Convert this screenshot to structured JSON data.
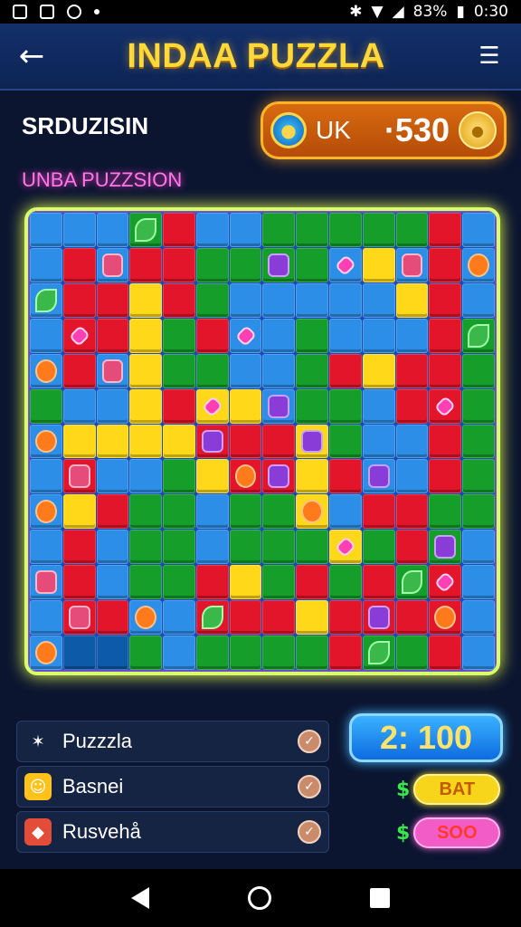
{
  "status_bar": {
    "battery": "83%",
    "time": "0:30"
  },
  "header": {
    "title": "INDAA PUZZLA"
  },
  "section": {
    "title": "SRDUZISIN"
  },
  "score": {
    "label": "UK",
    "value": "·530"
  },
  "subtitle": "UNBA PUZZSION",
  "board": {
    "rows": [
      "BBBGRBBGGGGGRB",
      "BRBRRGGGGBYBRB",
      "BRRYRGBBBBBYRB",
      "BRRYGRBBGBBBRG",
      "BRBYGGBBGRYRRG",
      "GBBYRYYBGGBRRG",
      "BYYYYRRRYGBBRG",
      "BRBBGYRRYRBBRG",
      "BYRGGBGGYBRRGG",
      "BRBGGBGGGYGRGB",
      "BRBGGRYGRGRGRB",
      "BRRBBRRRYRRRRB",
      "BDDGBGGGGRGGRB"
    ],
    "pieces": [
      {
        "row": 0,
        "col": 3,
        "type": "leaf"
      },
      {
        "row": 1,
        "col": 2,
        "type": "box"
      },
      {
        "row": 1,
        "col": 7,
        "type": "purple"
      },
      {
        "row": 1,
        "col": 9,
        "type": "gem"
      },
      {
        "row": 1,
        "col": 11,
        "type": "box"
      },
      {
        "row": 1,
        "col": 13,
        "type": "orange"
      },
      {
        "row": 2,
        "col": 0,
        "type": "leaf"
      },
      {
        "row": 3,
        "col": 1,
        "type": "gem"
      },
      {
        "row": 3,
        "col": 6,
        "type": "gem"
      },
      {
        "row": 3,
        "col": 13,
        "type": "leaf"
      },
      {
        "row": 4,
        "col": 0,
        "type": "orange"
      },
      {
        "row": 4,
        "col": 2,
        "type": "box"
      },
      {
        "row": 5,
        "col": 5,
        "type": "gem"
      },
      {
        "row": 5,
        "col": 7,
        "type": "purple"
      },
      {
        "row": 5,
        "col": 12,
        "type": "gem"
      },
      {
        "row": 6,
        "col": 0,
        "type": "orange"
      },
      {
        "row": 6,
        "col": 5,
        "type": "purple"
      },
      {
        "row": 6,
        "col": 8,
        "type": "purple"
      },
      {
        "row": 7,
        "col": 1,
        "type": "box"
      },
      {
        "row": 7,
        "col": 6,
        "type": "orange"
      },
      {
        "row": 7,
        "col": 7,
        "type": "purple"
      },
      {
        "row": 7,
        "col": 10,
        "type": "purple"
      },
      {
        "row": 8,
        "col": 0,
        "type": "orange"
      },
      {
        "row": 8,
        "col": 8,
        "type": "orange"
      },
      {
        "row": 9,
        "col": 9,
        "type": "gem"
      },
      {
        "row": 9,
        "col": 12,
        "type": "purple"
      },
      {
        "row": 10,
        "col": 0,
        "type": "box"
      },
      {
        "row": 10,
        "col": 11,
        "type": "leaf"
      },
      {
        "row": 10,
        "col": 12,
        "type": "gem"
      },
      {
        "row": 11,
        "col": 1,
        "type": "box"
      },
      {
        "row": 11,
        "col": 3,
        "type": "orange"
      },
      {
        "row": 11,
        "col": 5,
        "type": "leaf"
      },
      {
        "row": 11,
        "col": 10,
        "type": "purple"
      },
      {
        "row": 11,
        "col": 12,
        "type": "orange"
      },
      {
        "row": 12,
        "col": 0,
        "type": "orange"
      },
      {
        "row": 12,
        "col": 10,
        "type": "leaf"
      }
    ]
  },
  "list": [
    {
      "label": "Puzzzla",
      "icon": "star-icon"
    },
    {
      "label": "Basnei",
      "icon": "smiley-icon"
    },
    {
      "label": "Rusvehå",
      "icon": "gem-icon"
    }
  ],
  "timer": "2: 100",
  "rewards": [
    {
      "symbol": "$",
      "label": "BAT"
    },
    {
      "symbol": "$",
      "label": "SOO"
    }
  ],
  "colors": {
    "title": "#ffd83a",
    "board_glow": "#d8ff6a",
    "score_box": "#d86a10"
  }
}
